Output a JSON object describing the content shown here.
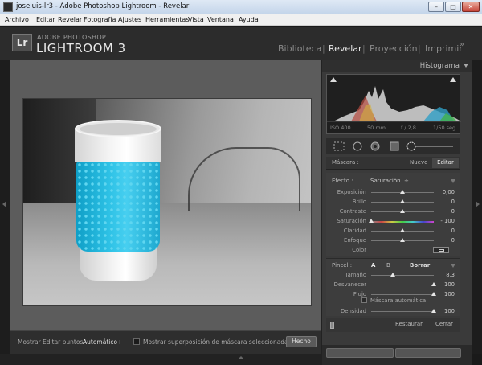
{
  "window": {
    "title": "joseluis-lr3 - Adobe Photoshop Lightroom - Revelar"
  },
  "menu": [
    "Archivo",
    "Editar",
    "Revelar",
    "Fotografía",
    "Ajustes",
    "Herramientas",
    "Vista",
    "Ventana",
    "Ayuda"
  ],
  "brand": {
    "logo": "Lr",
    "top": "ADOBE PHOTOSHOP",
    "main": "LIGHTROOM 3"
  },
  "modules": {
    "library": "Biblioteca",
    "develop": "Revelar",
    "slideshow": "Proyección",
    "print": "Imprimir",
    "more": "»",
    "separator": "|"
  },
  "histogram": {
    "title": "Histograma",
    "iso": "ISO 400",
    "focal": "50 mm",
    "aperture": "f / 2,8",
    "shutter": "1/50 seg."
  },
  "mask": {
    "label": "Máscara :",
    "new": "Nuevo",
    "edit": "Editar"
  },
  "effect": {
    "label": "Efecto :",
    "value": "Saturación",
    "value_arrows": "÷",
    "sliders": [
      {
        "label": "Exposición",
        "value": "0,00",
        "position": 0.5
      },
      {
        "label": "Brillo",
        "value": "0",
        "position": 0.5
      },
      {
        "label": "Contraste",
        "value": "0",
        "position": 0.5
      },
      {
        "label": "Saturación",
        "value": "- 100",
        "position": 0.0
      },
      {
        "label": "Claridad",
        "value": "0",
        "position": 0.5
      },
      {
        "label": "Enfoque",
        "value": "0",
        "position": 0.5
      }
    ],
    "color_label": "Color"
  },
  "brush": {
    "label": "Pincel :",
    "a": "A",
    "b": "B",
    "erase": "Borrar",
    "sliders": [
      {
        "label": "Tamaño",
        "value": "8,3",
        "position": 0.35
      },
      {
        "label": "Desvanecer",
        "value": "100",
        "position": 1.0
      },
      {
        "label": "Flujo",
        "value": "100",
        "position": 1.0
      }
    ],
    "automask": "Máscara automática",
    "density": {
      "label": "Densidad",
      "value": "100",
      "position": 1.0
    }
  },
  "actions": {
    "reset": "Restaurar",
    "close": "Cerrar"
  },
  "toolbar": {
    "show_points_label": "Mostrar Editar puntos:",
    "show_points_value": "Automático",
    "show_points_arrows": "÷",
    "overlay_label": "Mostrar superposición de máscara seleccionada",
    "done": "Hecho"
  }
}
